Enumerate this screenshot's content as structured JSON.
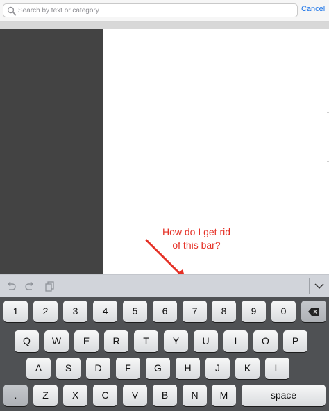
{
  "search": {
    "placeholder": "Search by text or category",
    "cancel_label": "Cancel"
  },
  "annotation": {
    "line1": "How do I get rid",
    "line2": "of this bar?",
    "color": "#e53025"
  },
  "shortcut_bar": {
    "icons": [
      "undo-icon",
      "redo-icon",
      "paste-icon",
      "dismiss-keyboard-icon"
    ]
  },
  "keyboard": {
    "row1": [
      "1",
      "2",
      "3",
      "4",
      "5",
      "6",
      "7",
      "8",
      "9",
      "0"
    ],
    "row1_action": "delete",
    "row2": [
      "Q",
      "W",
      "E",
      "R",
      "T",
      "Y",
      "U",
      "I",
      "O",
      "P"
    ],
    "row3": [
      "A",
      "S",
      "D",
      "F",
      "G",
      "H",
      "J",
      "K",
      "L"
    ],
    "row4_first": ".",
    "row4": [
      "Z",
      "X",
      "C",
      "V",
      "B",
      "N",
      "M"
    ],
    "space_label": "space"
  },
  "colors": {
    "accent": "#1a73e8",
    "sidebar": "#434343",
    "keyboard_bg": "#4f5154"
  }
}
